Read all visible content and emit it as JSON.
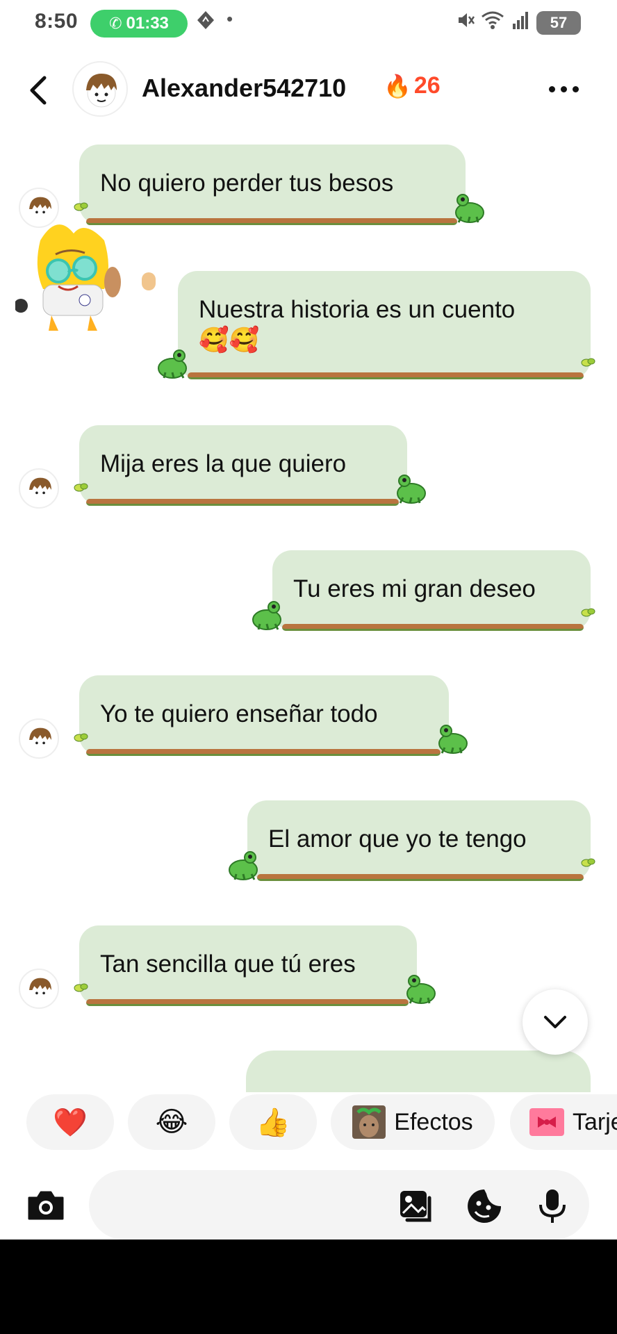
{
  "status_bar": {
    "time": "8:50",
    "call_timer": "01:33",
    "battery": "57",
    "dot": "•"
  },
  "header": {
    "contact_name": "Alexander542710",
    "streak_emoji": "🔥",
    "streak_count": "26"
  },
  "messages": [
    {
      "side": "left",
      "text": "No quiero perder tus besos"
    },
    {
      "side": "right",
      "text": "Nuestra historia es un cuento",
      "text2": "🥰🥰"
    },
    {
      "side": "left",
      "text": "Mija eres la que quiero"
    },
    {
      "side": "right",
      "text": "Tu eres mi gran deseo"
    },
    {
      "side": "left",
      "text": "Yo te quiero enseñar todo"
    },
    {
      "side": "right",
      "text": "El amor que yo te tengo"
    },
    {
      "side": "left",
      "text": "Tan sencilla que tú eres"
    }
  ],
  "quick_reactions": {
    "heart": "❤️",
    "laugh": "😂",
    "thumbs_up": "👍",
    "effects_label": "Efectos",
    "cards_label": "Tarje"
  },
  "composer": {
    "placeholder": ""
  },
  "colors": {
    "bubble": "#dcebd6",
    "call_green": "#3ecf6b",
    "streak_red": "#ff4a2a",
    "chip_bg": "#f4f4f4"
  }
}
